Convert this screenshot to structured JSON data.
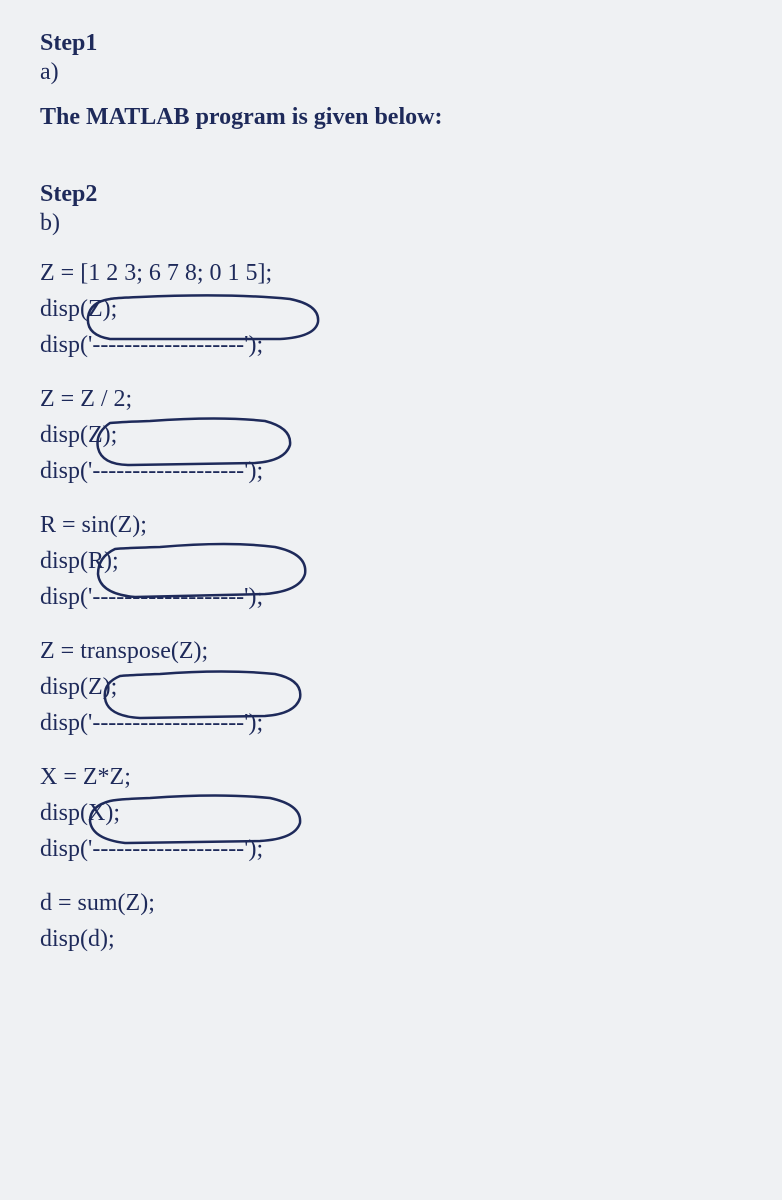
{
  "step1": {
    "heading": "Step1",
    "sub": "a)",
    "title": "The MATLAB program is given below:"
  },
  "step2": {
    "heading": "Step2",
    "sub": "b)"
  },
  "code": {
    "group1": {
      "line1": "Z = [1 2 3; 6 7 8; 0 1 5];",
      "line2": "disp(Z);",
      "line3": "disp('-------------------');"
    },
    "group2": {
      "line1": "Z = Z / 2;",
      "line2": "disp(Z);",
      "line3": "disp('-------------------');"
    },
    "group3": {
      "line1": "R = sin(Z);",
      "line2": "disp(R);",
      "line3": "disp('-------------------');"
    },
    "group4": {
      "line1": "Z = transpose(Z);",
      "line2": "disp(Z);",
      "line3": "disp('-------------------');"
    },
    "group5": {
      "line1": "X = Z*Z;",
      "line2": "disp(X);",
      "line3": "disp('-------------------');"
    },
    "group6": {
      "line1": "d = sum(Z);",
      "line2": "disp(d);"
    }
  }
}
